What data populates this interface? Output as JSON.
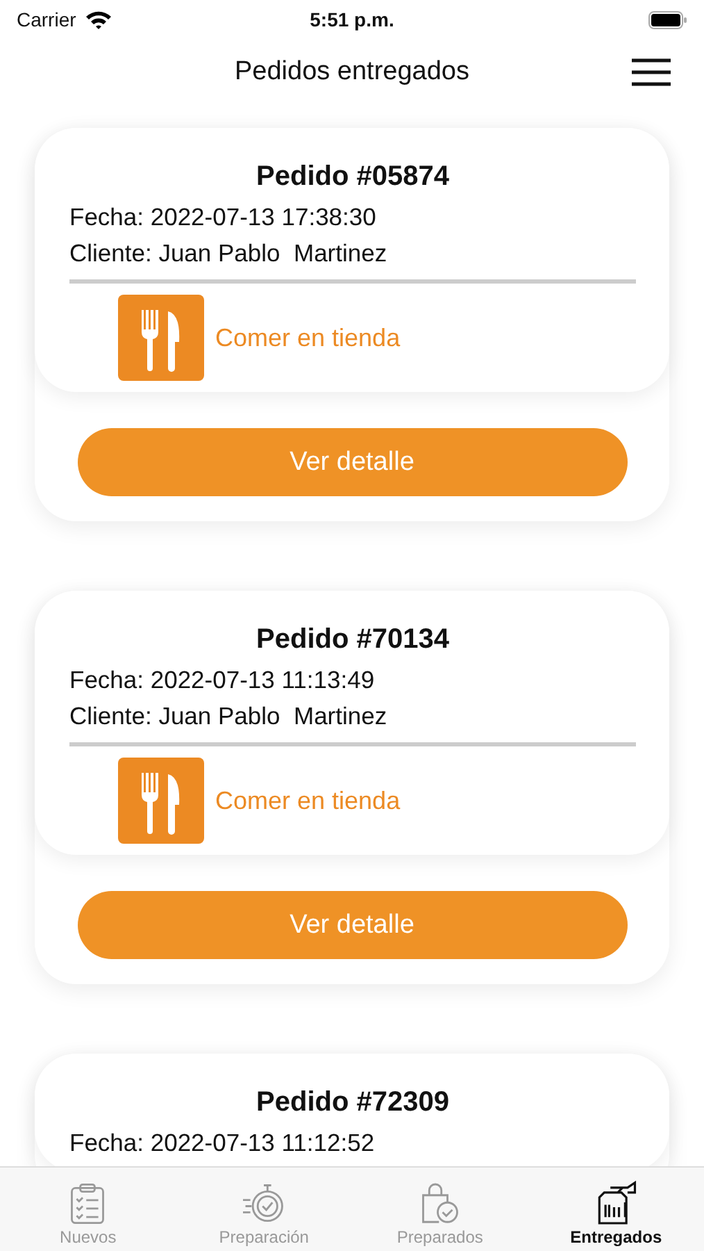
{
  "status_bar": {
    "carrier": "Carrier",
    "time": "5:51 p.m."
  },
  "header": {
    "title": "Pedidos entregados"
  },
  "orders": [
    {
      "title": "Pedido #05874",
      "date": "Fecha: 2022-07-13 17:38:30",
      "client": "Cliente: Juan Pablo  Martinez",
      "service": {
        "kind": "dine_in",
        "label": "Comer en tienda"
      },
      "button": "Ver detalle"
    },
    {
      "title": "Pedido #70134",
      "date": "Fecha: 2022-07-13 11:13:49",
      "client": "Cliente: Juan Pablo  Martinez",
      "service": {
        "kind": "dine_in",
        "label": "Comer en tienda"
      },
      "button": "Ver detalle"
    },
    {
      "title": "Pedido #72309",
      "date": "Fecha: 2022-07-13 11:12:52"
    }
  ],
  "tabs": [
    {
      "kind": "new",
      "label": "Nuevos",
      "selected": false
    },
    {
      "kind": "preparing",
      "label": "Preparación",
      "selected": false
    },
    {
      "kind": "prepared",
      "label": "Preparados",
      "selected": false
    },
    {
      "kind": "delivered",
      "label": "Entregados",
      "selected": true
    }
  ]
}
